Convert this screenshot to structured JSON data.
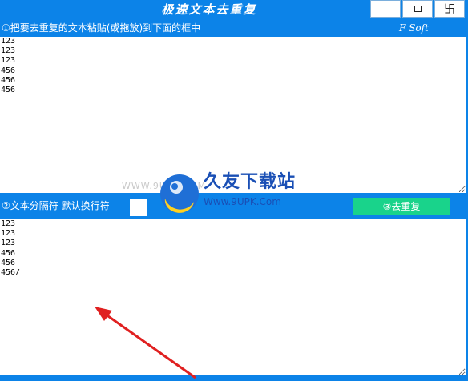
{
  "window": {
    "title": "极速文本去重复",
    "controls": {
      "minimize_icon": "minimize-icon",
      "maximize_icon": "maximize-icon",
      "close_glyph": "卐"
    }
  },
  "header": {
    "instruction": "①把要去重复的文本粘贴(或拖放)到下面的框中",
    "brand": "F Soft"
  },
  "input_text": "123\n123\n123\n456\n456\n456",
  "controls": {
    "separator_label": "②文本分隔符 默认换行符",
    "separator_value": "",
    "dedup_button": "③去重复"
  },
  "output_text": "123\n123\n123\n456\n456\n456/",
  "watermark": {
    "faint_text": "WWW.9UPK.COM",
    "brand_text": "久友下载站",
    "url": "Www.9UPK.Com"
  },
  "colors": {
    "window_blue": "#0c83e8",
    "button_green": "#19d38b",
    "arrow_red": "#e02020",
    "watermark_blue": "#1a4fb5"
  }
}
